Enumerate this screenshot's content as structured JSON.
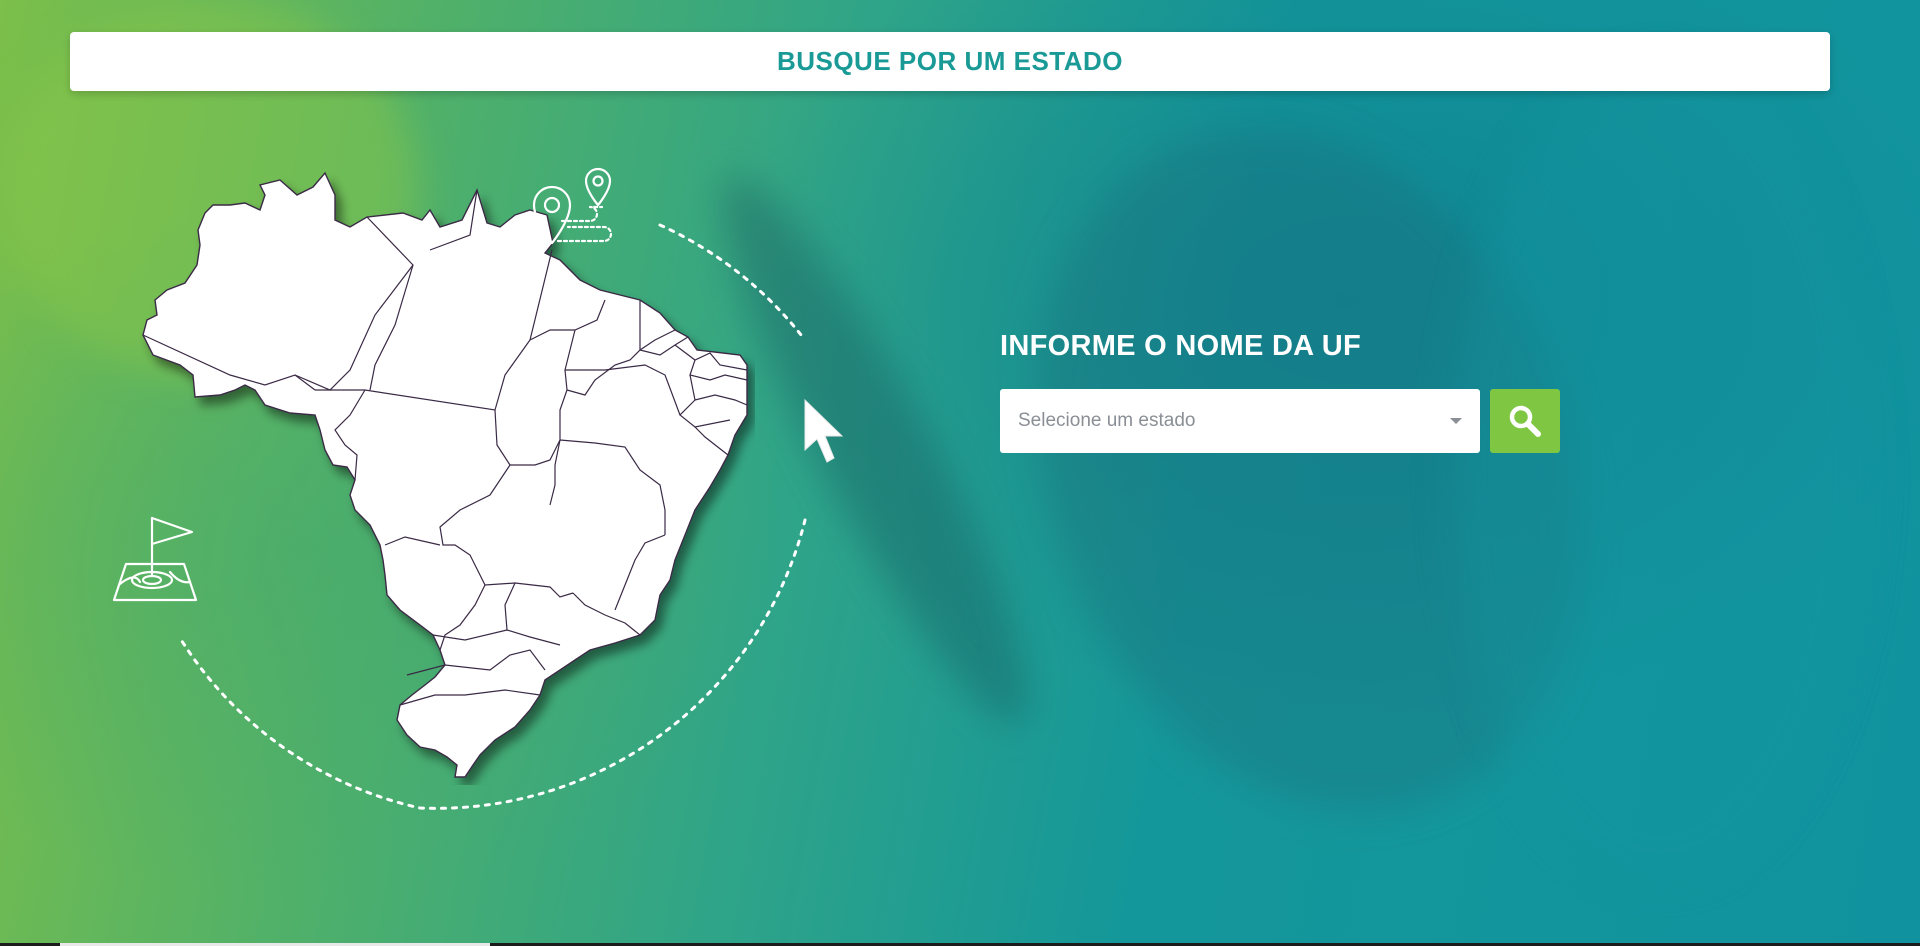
{
  "header": {
    "title": "BUSQUE POR UM ESTADO"
  },
  "form": {
    "label": "INFORME O NOME DA UF",
    "select": {
      "placeholder": "Selecione um estado"
    },
    "search_button": {
      "icon": "search-icon"
    }
  },
  "illustration": {
    "map_icon": "brazil-map",
    "pins_icon": "route-pins-icon",
    "flag_icon": "map-flag-icon",
    "cursor_icon": "cursor-arrow-icon"
  },
  "colors": {
    "header_text": "#1a9a96",
    "search_button": "#7fc742",
    "gradient_left": "#7cbf4a",
    "gradient_right": "#11939f"
  }
}
